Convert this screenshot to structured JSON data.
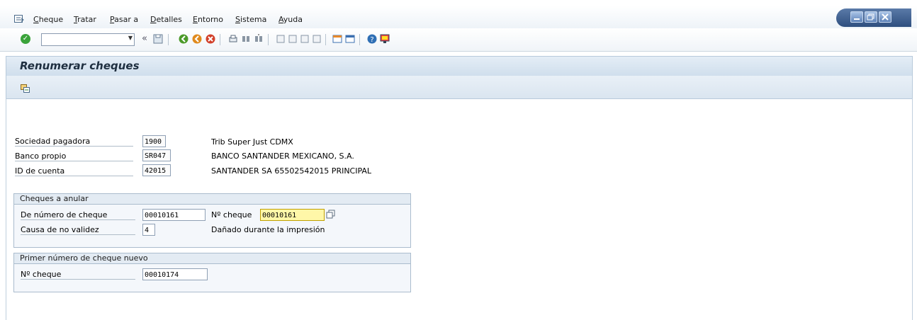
{
  "menu": {
    "items": [
      "Cheque",
      "Tratar",
      "Pasar a",
      "Detalles",
      "Entorno",
      "Sistema",
      "Ayuda"
    ],
    "icon": "menu-icon"
  },
  "window_controls": [
    "minimize-icon",
    "restore-icon",
    "close-icon"
  ],
  "toolbar": {
    "command_value": "",
    "icons": [
      "enter-icon",
      "back-icon",
      "exit-icon",
      "cancel-icon",
      "print-icon",
      "find-icon",
      "find-next-icon",
      "first-page-icon",
      "prev-page-icon",
      "next-page-icon",
      "last-page-icon",
      "new-session-icon",
      "shortcut-icon",
      "help-icon",
      "layout-icon"
    ]
  },
  "title": "Renumerar cheques",
  "app_toolbar": {
    "icon": "execute-icon"
  },
  "header_fields": [
    {
      "label": "Sociedad pagadora",
      "value": "1900",
      "desc": "Trib Super Just CDMX"
    },
    {
      "label": "Banco propio",
      "value": "SR047",
      "desc": "BANCO SANTANDER MEXICANO, S.A."
    },
    {
      "label": "ID de cuenta",
      "value": "42015",
      "desc": "SANTANDER SA 65502542015 PRINCIPAL"
    }
  ],
  "group_void": {
    "title": "Cheques a anular",
    "from_label": "De número de cheque",
    "from_value": "00010161",
    "to_label": "Nº cheque",
    "to_value": "00010161",
    "reason_label": "Causa de no validez",
    "reason_value": "4",
    "reason_desc": "Dañado durante la impresión"
  },
  "group_new": {
    "title": "Primer número de cheque nuevo",
    "label": "Nº cheque",
    "value": "00010174"
  },
  "colors": {
    "focus_field": "#fff7a8",
    "title_bar": "#d4e2ef",
    "ok_green": "#3aa33a"
  }
}
